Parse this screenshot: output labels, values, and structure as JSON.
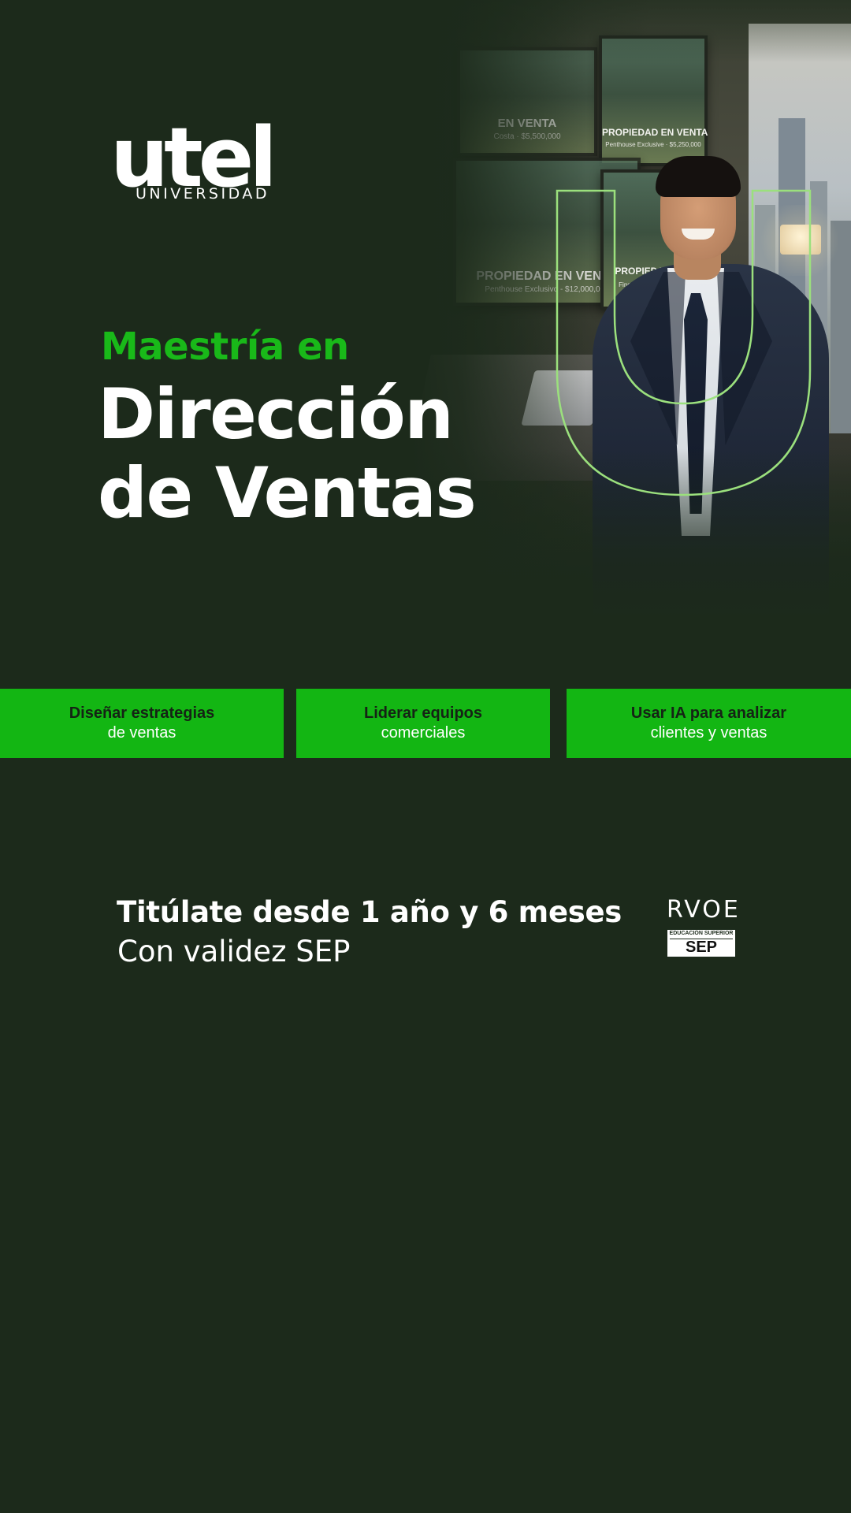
{
  "brand": {
    "logo_word": "utel",
    "logo_sub": "UNIVERSIDAD"
  },
  "hero": {
    "kicker": "Maestría en",
    "title_line_1": "Dirección",
    "title_line_2": "de Ventas",
    "frames": [
      {
        "title": "EN VENTA",
        "subtitle": "Costa · $5,500,000"
      },
      {
        "title": "PROPIEDAD EN VENTA",
        "subtitle": "Penthouse Exclusive · $5,250,000"
      },
      {
        "title": "PROPIEDAD EN VENTA",
        "subtitle": "Penthouse Exclusivo - $12,000,000"
      },
      {
        "title": "PROPIEDAD EN",
        "subtitle": "Finca con Viñedos · $1"
      }
    ]
  },
  "benefits": [
    {
      "line1": "Diseñar estrategias",
      "line2": "de ventas"
    },
    {
      "line1": "Liderar equipos",
      "line2": "comerciales"
    },
    {
      "line1": "Usar IA para analizar",
      "line2": "clientes y ventas"
    }
  ],
  "degree": {
    "duration": "Titúlate desde 1 año y 6 meses",
    "validity": "Con validez SEP"
  },
  "seal": {
    "top": "RVOE",
    "middle": "EDUCACIÓN SUPERIOR",
    "bottom": "SEP"
  },
  "colors": {
    "background": "#1c2a1b",
    "accent_green": "#13b613",
    "kicker_green": "#19b919",
    "outline_green": "#9be07d",
    "text_white": "#ffffff",
    "text_dark": "#152315"
  }
}
